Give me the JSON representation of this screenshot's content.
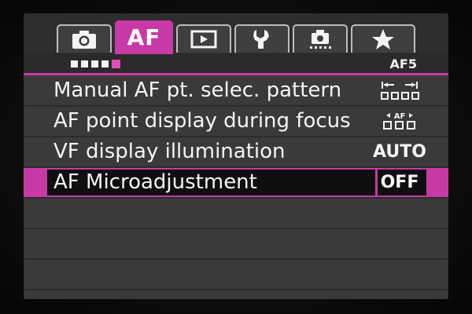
{
  "tabs": [
    {
      "name": "camera",
      "icon": "camera-icon",
      "label": ""
    },
    {
      "name": "af",
      "icon": "",
      "label": "AF",
      "active": true
    },
    {
      "name": "playback",
      "icon": "playback-icon",
      "label": ""
    },
    {
      "name": "setup",
      "icon": "wrench-icon",
      "label": ""
    },
    {
      "name": "custom-functions",
      "icon": "custom-functions-icon",
      "label": ""
    },
    {
      "name": "my-menu",
      "icon": "star-icon",
      "label": ""
    }
  ],
  "page": {
    "indicator_count": 5,
    "current_index": 5,
    "label": "AF5"
  },
  "menu": {
    "items": [
      {
        "label": "Manual AF pt. selec. pattern",
        "value_icon": "af-pattern-stop-icon",
        "value": ""
      },
      {
        "label": "AF point display during focus",
        "value_icon": "af-point-display-icon",
        "value": ""
      },
      {
        "label": "VF display illumination",
        "value": "AUTO"
      },
      {
        "label": "AF Microadjustment",
        "value": "OFF",
        "selected": true
      }
    ]
  },
  "colors": {
    "accent": "#c73aa6",
    "background": "#3a3a3a",
    "text": "#f4f4f4"
  }
}
